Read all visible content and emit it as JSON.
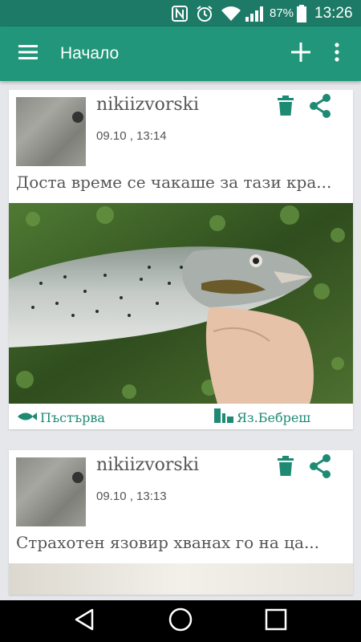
{
  "status_bar": {
    "battery": "87%",
    "time": "13:26"
  },
  "app_bar": {
    "title": "Начало"
  },
  "posts": [
    {
      "username": "nikiizvorski",
      "timestamp": "09.10 , 13:14",
      "text": "Доста време се чакаше за тази кра...",
      "species": "Пъстърва",
      "location": "Яз.Бебреш"
    },
    {
      "username": "nikiizvorski",
      "timestamp": "09.10 , 13:13",
      "text": "Страхотен язовир хванах го на ца..."
    }
  ],
  "colors": {
    "primary": "#21967a",
    "primary_dark": "#1c7a66",
    "accent": "#1e8a74"
  },
  "icons": [
    "nfc-icon",
    "alarm-icon",
    "wifi-icon",
    "signal-icon",
    "battery-icon",
    "menu-icon",
    "add-icon",
    "more-vert-icon",
    "delete-icon",
    "share-icon",
    "fish-icon",
    "dam-icon",
    "back-icon",
    "home-icon",
    "recents-icon"
  ]
}
